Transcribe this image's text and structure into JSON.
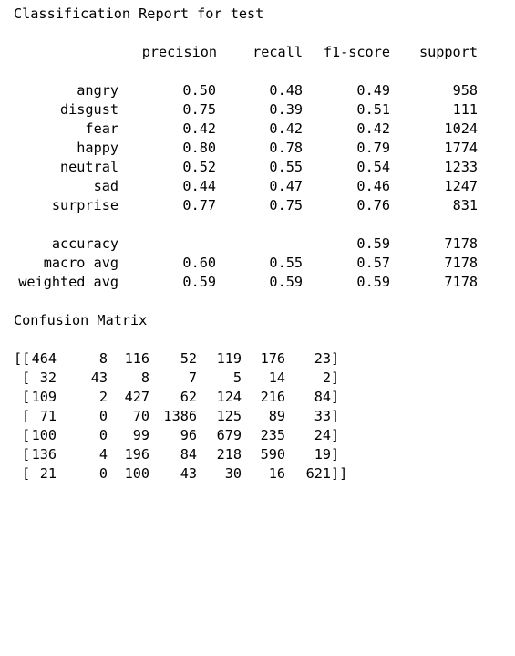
{
  "report_title": "Classification Report for test",
  "report": {
    "headers": [
      "precision",
      "recall",
      "f1-score",
      "support"
    ],
    "rows": [
      {
        "label": "angry",
        "precision": "0.50",
        "recall": "0.48",
        "f1": "0.49",
        "support": "958"
      },
      {
        "label": "disgust",
        "precision": "0.75",
        "recall": "0.39",
        "f1": "0.51",
        "support": "111"
      },
      {
        "label": "fear",
        "precision": "0.42",
        "recall": "0.42",
        "f1": "0.42",
        "support": "1024"
      },
      {
        "label": "happy",
        "precision": "0.80",
        "recall": "0.78",
        "f1": "0.79",
        "support": "1774"
      },
      {
        "label": "neutral",
        "precision": "0.52",
        "recall": "0.55",
        "f1": "0.54",
        "support": "1233"
      },
      {
        "label": "sad",
        "precision": "0.44",
        "recall": "0.47",
        "f1": "0.46",
        "support": "1247"
      },
      {
        "label": "surprise",
        "precision": "0.77",
        "recall": "0.75",
        "f1": "0.76",
        "support": "831"
      }
    ],
    "summary": [
      {
        "label": "accuracy",
        "precision": "",
        "recall": "",
        "f1": "0.59",
        "support": "7178"
      },
      {
        "label": "macro avg",
        "precision": "0.60",
        "recall": "0.55",
        "f1": "0.57",
        "support": "7178"
      },
      {
        "label": "weighted avg",
        "precision": "0.59",
        "recall": "0.59",
        "f1": "0.59",
        "support": "7178"
      }
    ]
  },
  "matrix_title": "Confusion Matrix",
  "confusion_matrix": [
    [
      "464",
      "8",
      "116",
      "52",
      "119",
      "176",
      "23"
    ],
    [
      "32",
      "43",
      "8",
      "7",
      "5",
      "14",
      "2"
    ],
    [
      "109",
      "2",
      "427",
      "62",
      "124",
      "216",
      "84"
    ],
    [
      "71",
      "0",
      "70",
      "1386",
      "125",
      "89",
      "33"
    ],
    [
      "100",
      "0",
      "99",
      "96",
      "679",
      "235",
      "24"
    ],
    [
      "136",
      "4",
      "196",
      "84",
      "218",
      "590",
      "19"
    ],
    [
      "21",
      "0",
      "100",
      "43",
      "30",
      "16",
      "621"
    ]
  ],
  "matrix_brackets": {
    "first_open": "[[",
    "row_open": "[",
    "row_close": "]",
    "last_close": "]]"
  }
}
